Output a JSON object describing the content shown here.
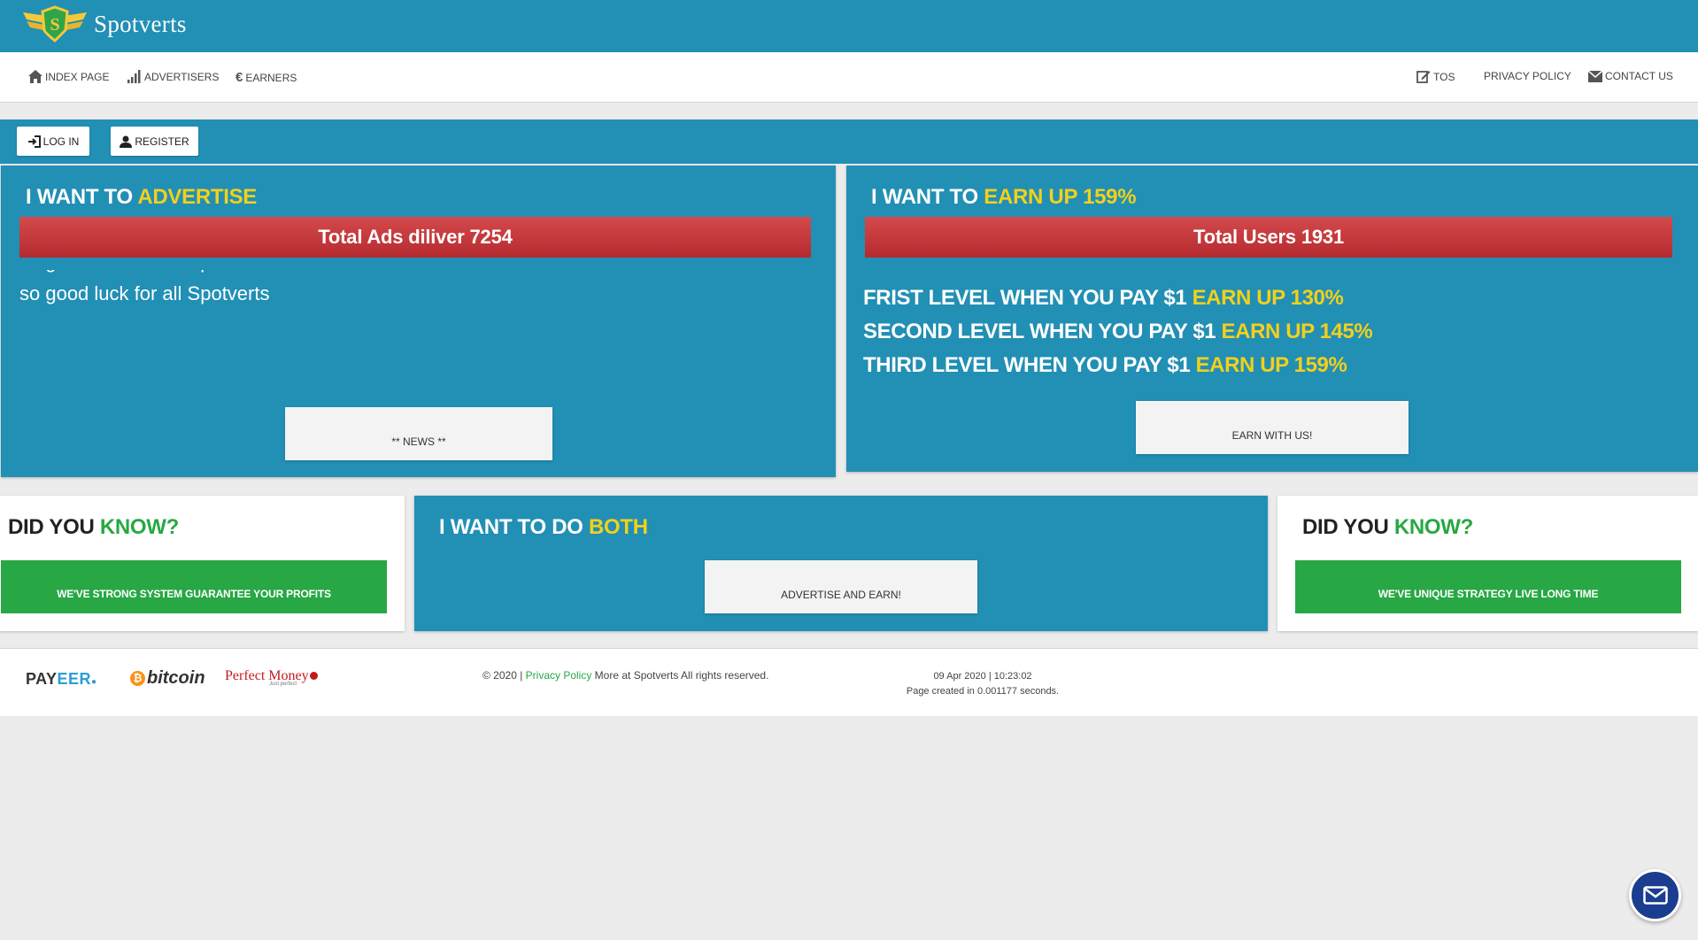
{
  "brand": {
    "name": "Spotverts"
  },
  "nav": {
    "left": [
      {
        "label": "INDEX PAGE",
        "icon": "home-icon"
      },
      {
        "label": "ADVERTISERS",
        "icon": "bar-chart-icon"
      },
      {
        "label": "EARNERS",
        "icon": "euro-icon"
      }
    ],
    "right": [
      {
        "label": "TOS",
        "icon": "edit-icon"
      },
      {
        "label": "PRIVACY POLICY"
      },
      {
        "label": "CONTACT US",
        "icon": "envelope-icon"
      }
    ]
  },
  "auth": {
    "login": "LOG IN",
    "register": "REGISTER"
  },
  "advertise": {
    "title_prefix": "I WANT TO ",
    "title_highlight": "ADVERTISE",
    "stat": "Total Ads diliver 7254",
    "text": "so good luck for all Spotverts",
    "button": "** NEWS **"
  },
  "earn": {
    "title_prefix": "I WANT TO ",
    "title_highlight": "EARN UP 159%",
    "stat": "Total Users 1931",
    "levels": [
      {
        "text": "FRIST LEVEL WHEN YOU PAY $1 ",
        "highlight": "EARN UP 130%"
      },
      {
        "text": "SECOND LEVEL WHEN YOU PAY $1 ",
        "highlight": "EARN UP 145%"
      },
      {
        "text": "THIRD LEVEL WHEN YOU PAY $1 ",
        "highlight": "EARN UP 159%"
      }
    ],
    "button": "EARN WITH US!"
  },
  "did_you_know_left": {
    "title_prefix": "DID YOU ",
    "title_highlight": "KNOW?",
    "button": "WE'VE STRONG SYSTEM GUARANTEE YOUR PROFITS"
  },
  "both": {
    "title_prefix": "I WANT TO DO ",
    "title_highlight": "BOTH",
    "button": "ADVERTISE AND EARN!"
  },
  "did_you_know_right": {
    "title_prefix": "DID YOU ",
    "title_highlight": "KNOW?",
    "button": "WE'VE UNIQUE STRATEGY LIVE LONG TIME"
  },
  "footer": {
    "payments": [
      "PAYEER",
      "bitcoin",
      "Perfect Money"
    ],
    "payeer_a": "PAY",
    "payeer_b": "EER",
    "pm_sub": "Just perfect",
    "copyright_prefix": "© 2020 | ",
    "privacy_link": "Privacy Policy",
    "copyright_suffix": " More at Spotverts All rights reserved.",
    "datetime": "09 Apr 2020 | 10:23:02",
    "page_created": "Page created in 0.001177 seconds."
  },
  "colors": {
    "primary": "#228fb4",
    "accent_yellow": "#f3d01c",
    "accent_green": "#28a745",
    "stat_red": "#c0383b",
    "chat": "#1a3d8f"
  }
}
